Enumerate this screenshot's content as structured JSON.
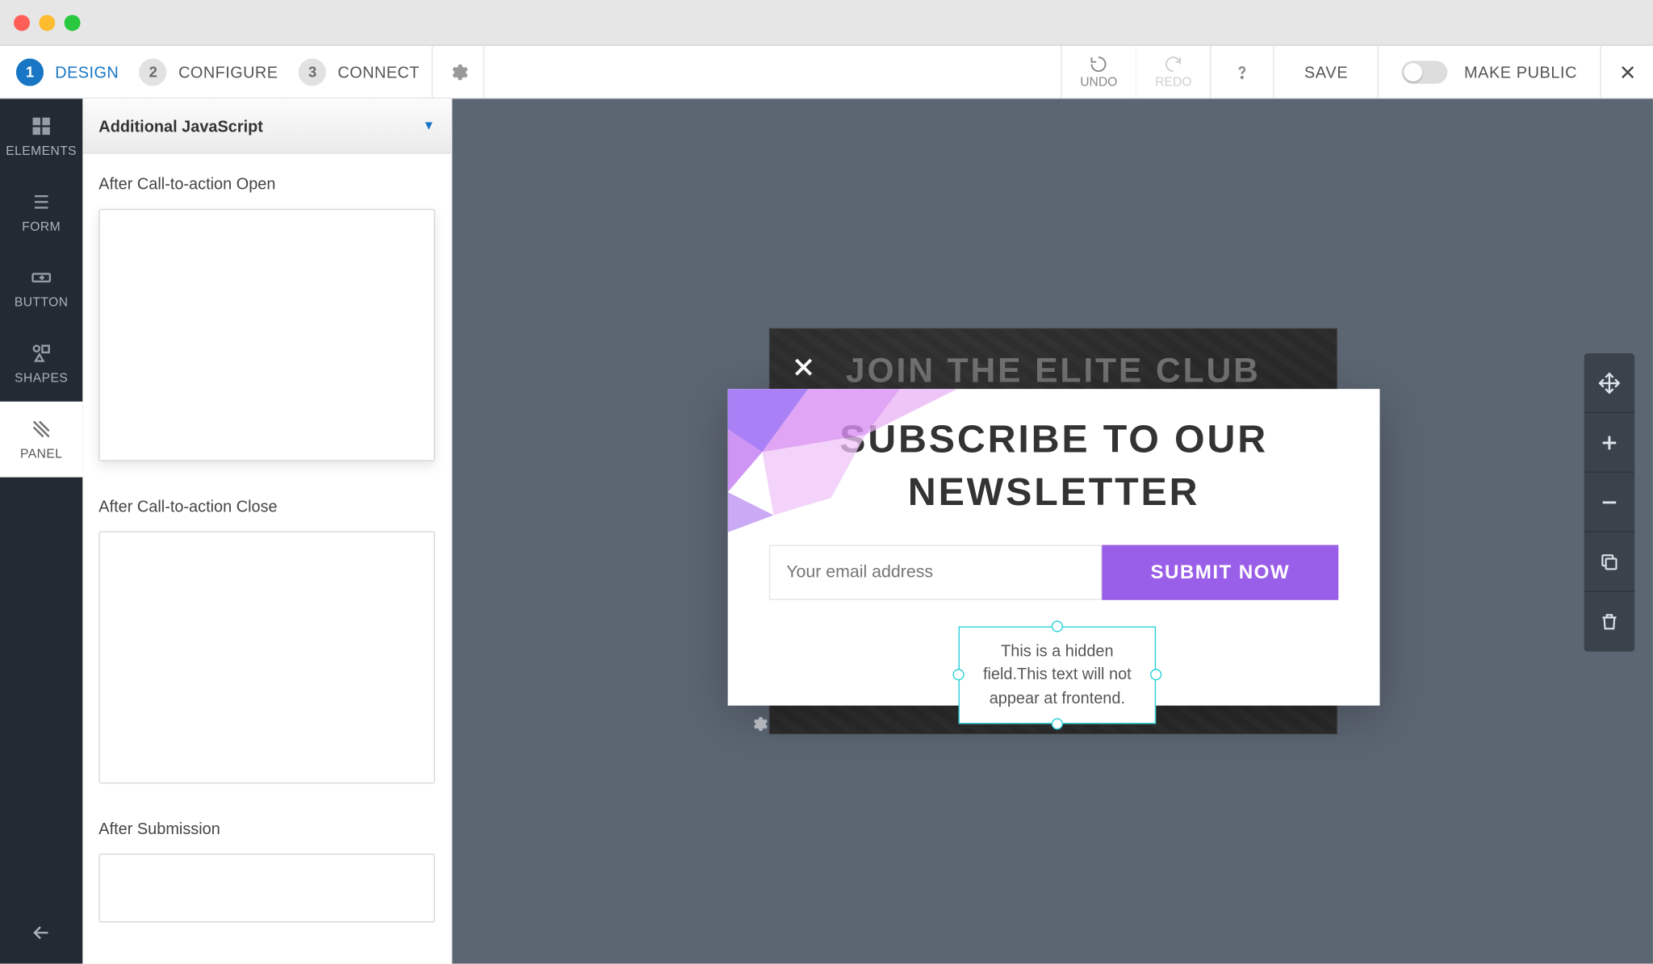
{
  "steps": [
    {
      "num": "1",
      "label": "DESIGN"
    },
    {
      "num": "2",
      "label": "CONFIGURE"
    },
    {
      "num": "3",
      "label": "CONNECT"
    }
  ],
  "topbar": {
    "undo": "UNDO",
    "redo": "REDO",
    "save": "SAVE",
    "make_public": "MAKE PUBLIC"
  },
  "sidebar": {
    "items": [
      "ELEMENTS",
      "FORM",
      "BUTTON",
      "SHAPES",
      "PANEL"
    ]
  },
  "panel": {
    "header": "Additional JavaScript",
    "fields": [
      {
        "label": "After Call-to-action Open",
        "value": ""
      },
      {
        "label": "After Call-to-action Close",
        "value": ""
      },
      {
        "label": "After Submission",
        "value": ""
      }
    ]
  },
  "canvas": {
    "bg_title": "JOIN THE ELITE CLUB",
    "popup_title": "SUBSCRIBE TO OUR NEWSLETTER",
    "email_placeholder": "Your email address",
    "submit_label": "SUBMIT NOW",
    "hidden_text": "This is a hidden field.This text will not appear at frontend."
  }
}
